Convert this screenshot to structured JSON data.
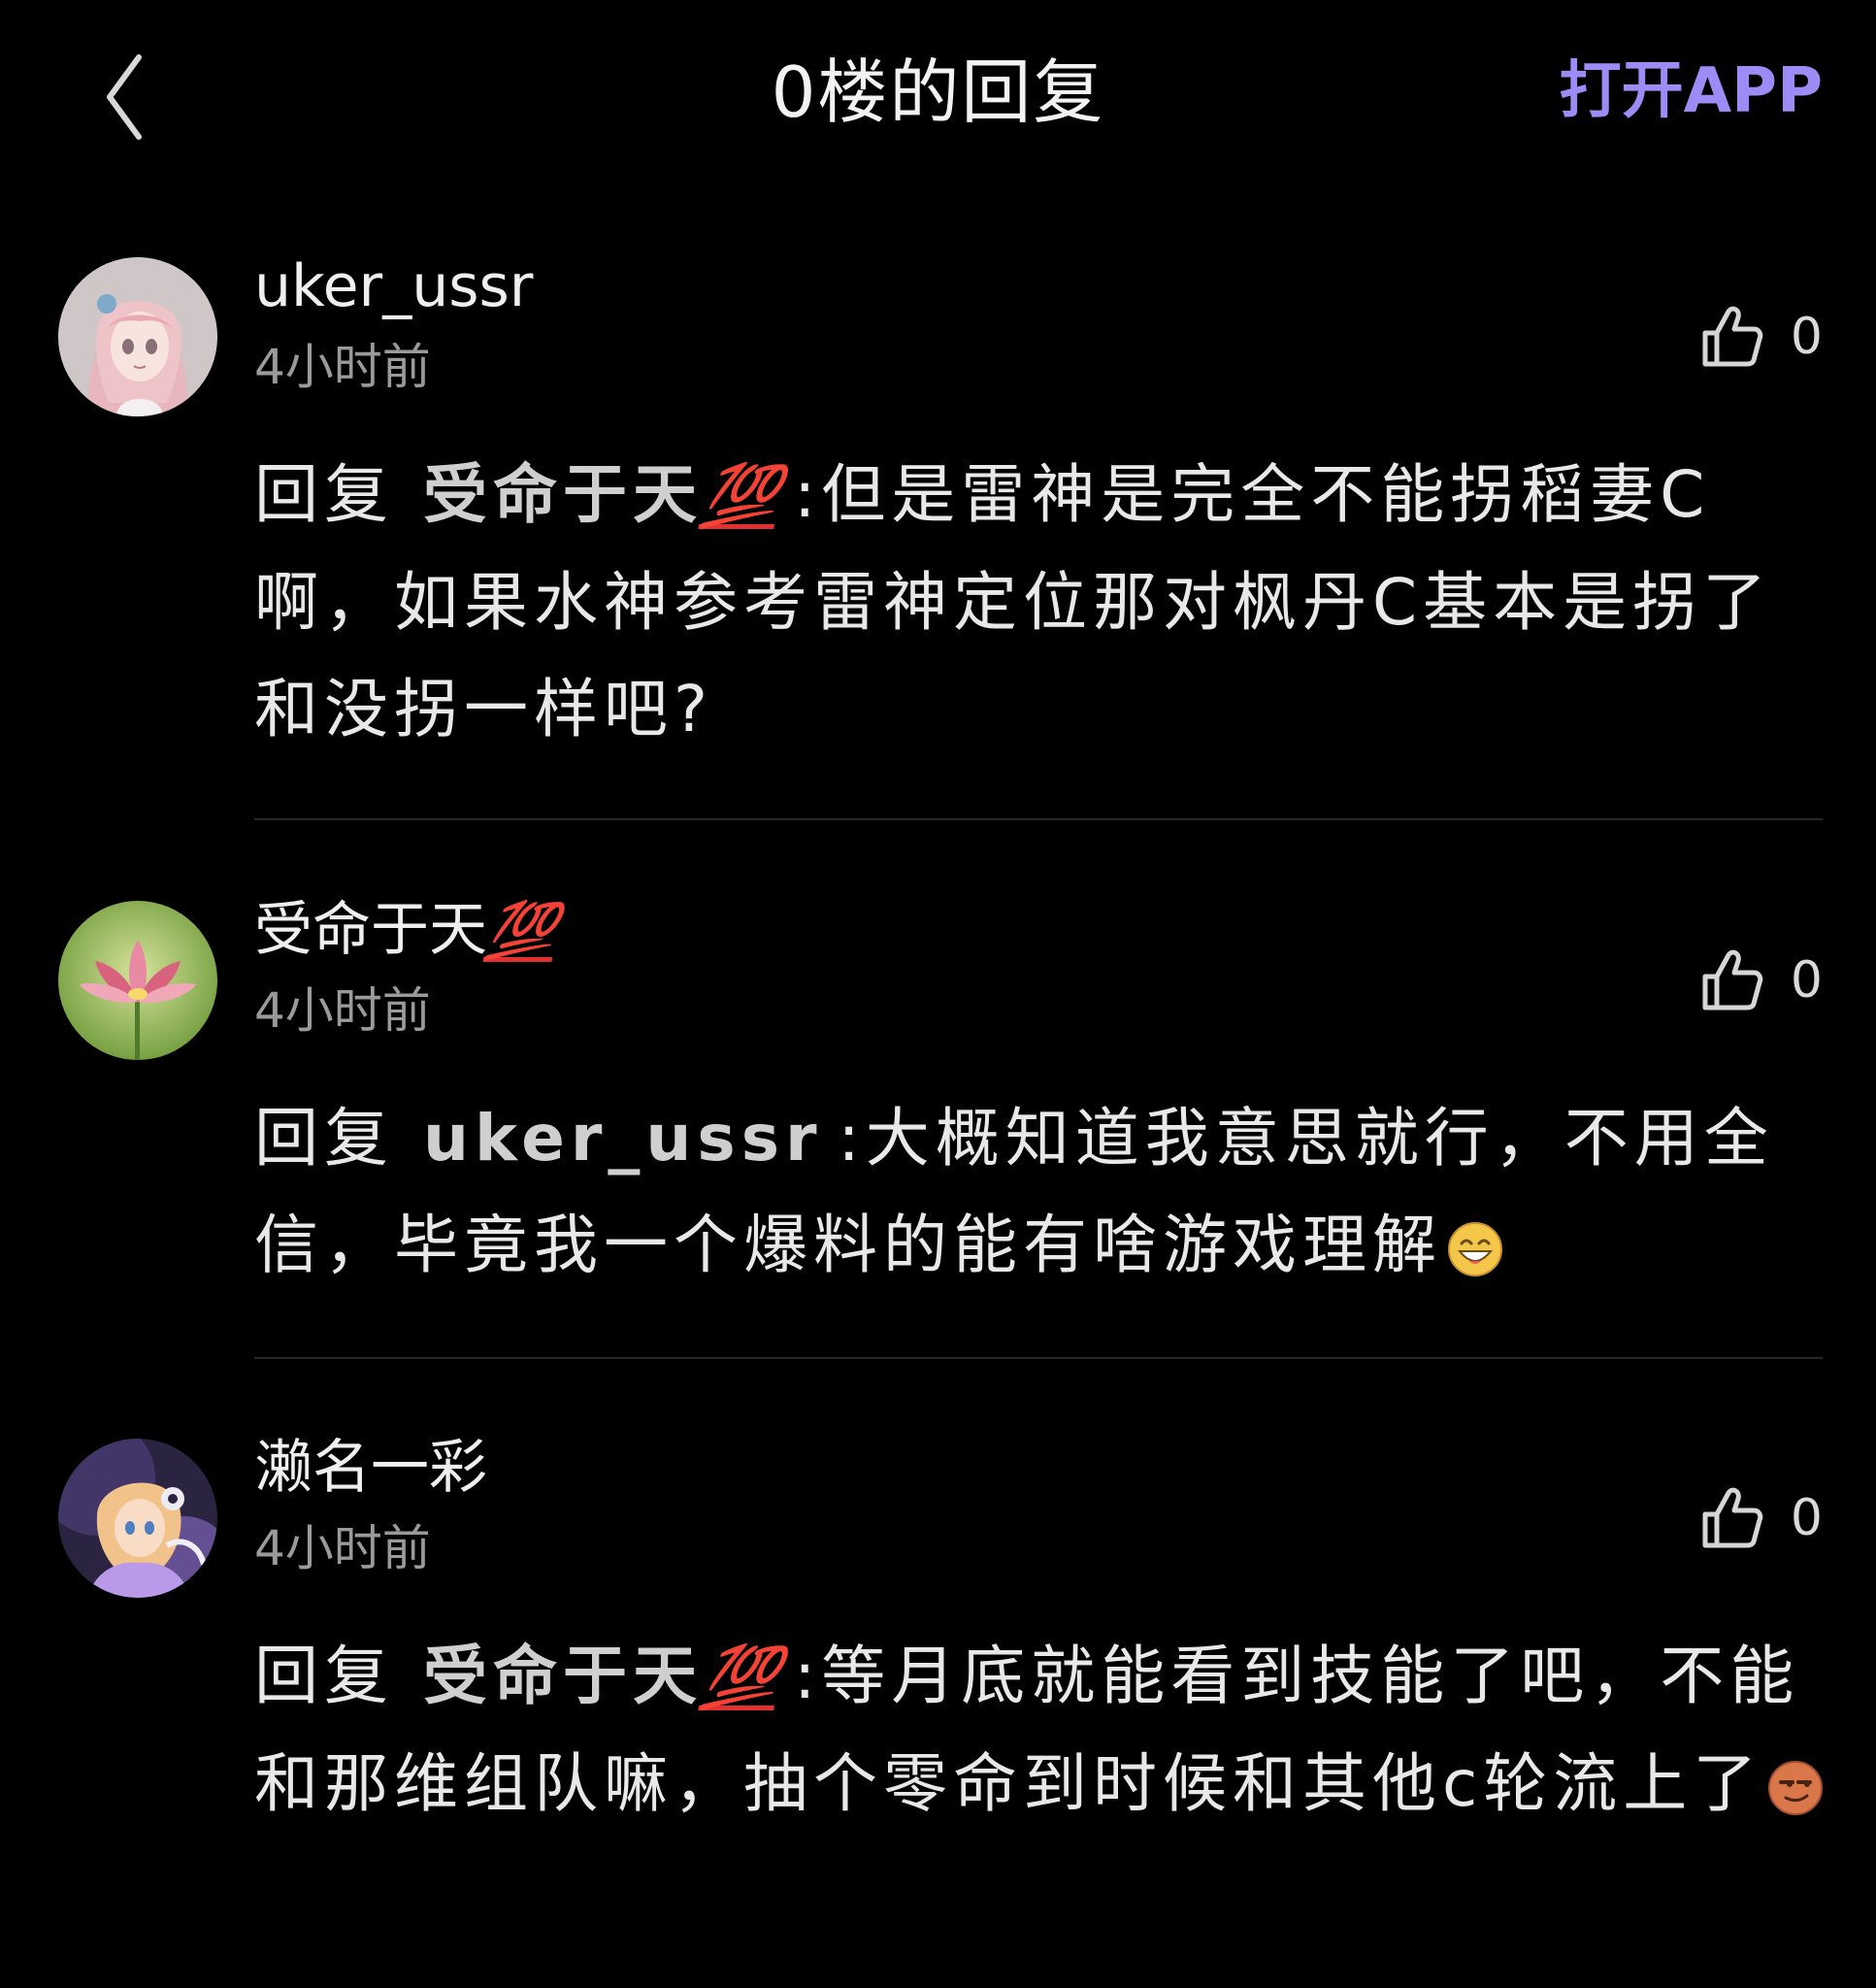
{
  "header": {
    "back_icon": "chevron-left-icon",
    "title": "0楼的回复",
    "open_app_label": "打开APP",
    "accent_color": "#9d8cf5"
  },
  "replies": [
    {
      "username": "uker_ussr",
      "username_badge": "",
      "time": "4小时前",
      "like_icon": "thumbs-up-icon",
      "likes": "0",
      "reply_prefix": "回复",
      "reply_target": "受命于天",
      "reply_target_badge": "💯",
      "content": ":但是雷神是完全不能拐稻妻C啊，如果水神参考雷神定位那对枫丹C基本是拐了和没拐一样吧?",
      "emoji": ""
    },
    {
      "username": "受命于天",
      "username_badge": "💯",
      "time": "4小时前",
      "like_icon": "thumbs-up-icon",
      "likes": "0",
      "reply_prefix": "回复",
      "reply_target": "uker_ussr",
      "reply_target_badge": "",
      "content": ":大概知道我意思就行，不用全信，毕竟我一个爆料的能有啥游戏理解",
      "emoji": "grinning-face-emoji"
    },
    {
      "username": "濑名一彩",
      "username_badge": "",
      "time": "4小时前",
      "like_icon": "thumbs-up-icon",
      "likes": "0",
      "reply_prefix": "回复",
      "reply_target": "受命于天",
      "reply_target_badge": "💯",
      "content": ":等月底就能看到技能了吧，不能和那维组队嘛，抽个零命到时候和其他c轮流上了",
      "emoji": "smirking-face-emoji"
    }
  ]
}
